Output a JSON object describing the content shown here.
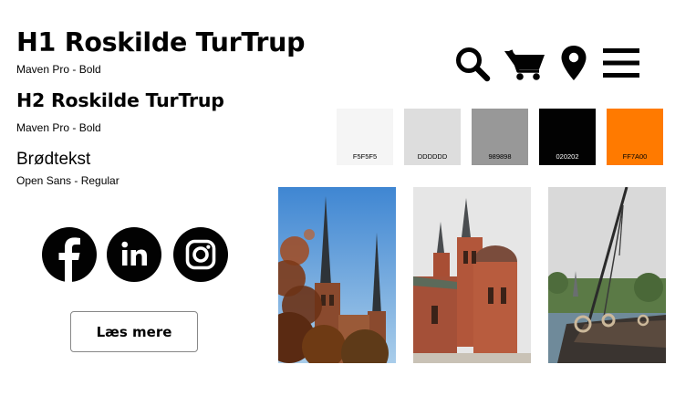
{
  "typography": {
    "h1": {
      "text": "H1 Roskilde TurTrup",
      "font_caption": "Maven Pro - Bold"
    },
    "h2": {
      "text": "H2 Roskilde TurTrup",
      "font_caption": "Maven Pro - Bold"
    },
    "body": {
      "text": "Brødtekst",
      "font_caption": "Open Sans - Regular"
    }
  },
  "icons": [
    "search-icon",
    "cart-icon",
    "location-pin-icon",
    "menu-icon"
  ],
  "palette": [
    {
      "label": "F5F5F5",
      "hex": "#F5F5F5",
      "text_color": "#020202"
    },
    {
      "label": "DDDDDD",
      "hex": "#DDDDDD",
      "text_color": "#020202"
    },
    {
      "label": "989898",
      "hex": "#989898",
      "text_color": "#020202"
    },
    {
      "label": "020202",
      "hex": "#020202",
      "text_color": "#ffffff"
    },
    {
      "label": "FF7A00",
      "hex": "#FF7A00",
      "text_color": "#020202"
    }
  ],
  "social": [
    "facebook-icon",
    "linkedin-icon",
    "instagram-icon"
  ],
  "button": {
    "label": "Læs mere"
  },
  "photos": [
    "roskilde-cathedral-spires-photo",
    "roskilde-cathedral-brick-photo",
    "viking-ship-photo"
  ]
}
